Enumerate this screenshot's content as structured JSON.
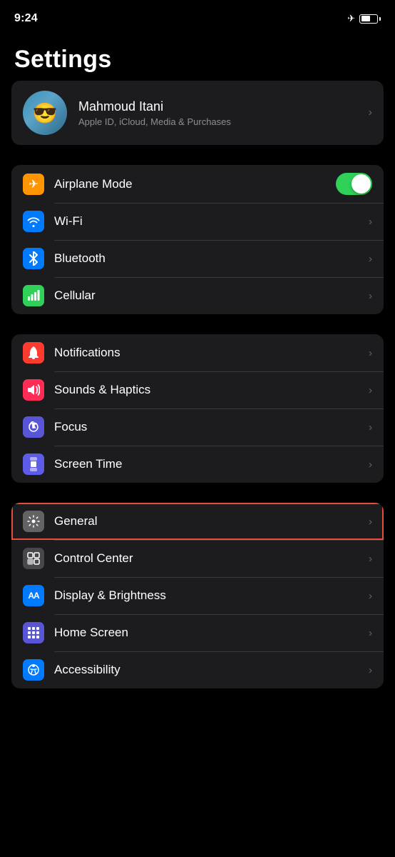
{
  "statusBar": {
    "time": "9:24",
    "locationIcon": "✈",
    "batteryLevel": 60
  },
  "pageTitle": "Settings",
  "profile": {
    "name": "Mahmoud Itani",
    "subtitle": "Apple ID, iCloud, Media & Purchases",
    "avatarEmoji": "😎"
  },
  "section1": {
    "items": [
      {
        "id": "airplane-mode",
        "label": "Airplane Mode",
        "icon": "✈",
        "iconBg": "icon-orange",
        "hasToggle": true,
        "toggleOn": true,
        "hasChevron": false
      },
      {
        "id": "wifi",
        "label": "Wi-Fi",
        "icon": "wifi",
        "iconBg": "icon-blue",
        "hasToggle": false,
        "hasChevron": true
      },
      {
        "id": "bluetooth",
        "label": "Bluetooth",
        "icon": "bluetooth",
        "iconBg": "icon-bluetooth",
        "hasToggle": false,
        "hasChevron": true
      },
      {
        "id": "cellular",
        "label": "Cellular",
        "icon": "cellular",
        "iconBg": "icon-green",
        "hasToggle": false,
        "hasChevron": true
      }
    ]
  },
  "section2": {
    "items": [
      {
        "id": "notifications",
        "label": "Notifications",
        "icon": "bell",
        "iconBg": "icon-red",
        "hasChevron": true
      },
      {
        "id": "sounds",
        "label": "Sounds & Haptics",
        "icon": "sound",
        "iconBg": "icon-pink-red",
        "hasChevron": true
      },
      {
        "id": "focus",
        "label": "Focus",
        "icon": "moon",
        "iconBg": "icon-purple",
        "hasChevron": true
      },
      {
        "id": "screen-time",
        "label": "Screen Time",
        "icon": "hourglass",
        "iconBg": "icon-indigo",
        "hasChevron": true
      }
    ]
  },
  "section3": {
    "items": [
      {
        "id": "general",
        "label": "General",
        "icon": "gear",
        "iconBg": "icon-gray",
        "hasChevron": true,
        "selected": true
      },
      {
        "id": "control-center",
        "label": "Control Center",
        "icon": "sliders",
        "iconBg": "icon-dark-gray",
        "hasChevron": true
      },
      {
        "id": "display-brightness",
        "label": "Display & Brightness",
        "icon": "AA",
        "iconBg": "icon-display",
        "hasChevron": true
      },
      {
        "id": "home-screen",
        "label": "Home Screen",
        "icon": "grid",
        "iconBg": "icon-home",
        "hasChevron": true
      },
      {
        "id": "accessibility",
        "label": "Accessibility",
        "icon": "person",
        "iconBg": "icon-access",
        "hasChevron": true
      }
    ]
  },
  "chevronChar": "›",
  "icons": {
    "wifi": "📶",
    "bluetooth": "𝔅",
    "cellular": "📡",
    "bell": "🔔",
    "sound": "🔊",
    "moon": "🌙",
    "hourglass": "⏳",
    "gear": "⚙",
    "sliders": "⚙",
    "AA": "AA",
    "grid": "⊞",
    "person": "♿"
  }
}
